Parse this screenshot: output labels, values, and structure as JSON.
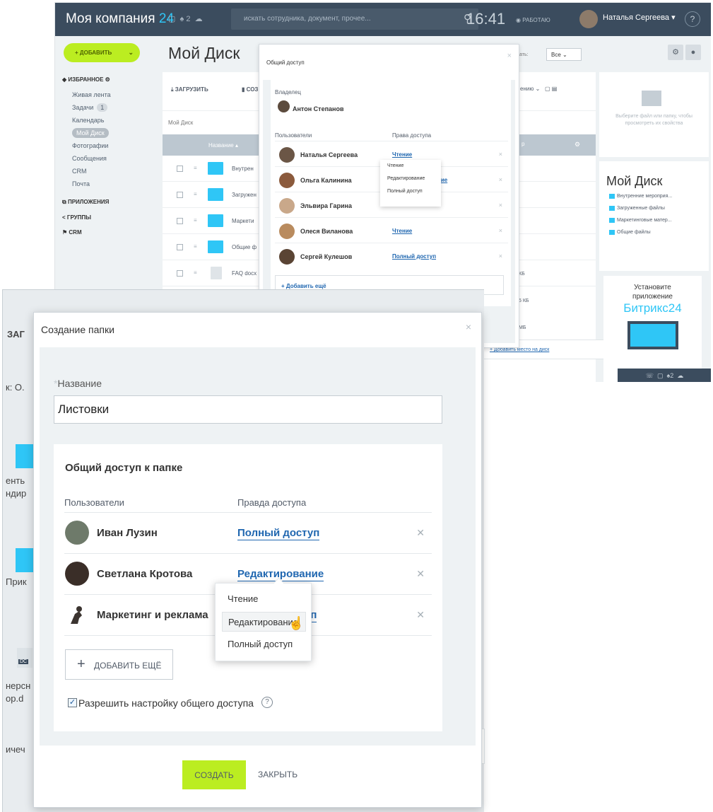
{
  "background": {
    "app_title": "Моя компания",
    "app_title_suffix": "24",
    "search_placeholder": "искать сотрудника, документ, прочее...",
    "clock": "16:41",
    "work_status": "РАБОТАЮ",
    "user_name": "Наталья Сергеева",
    "add_button": "+ ДОБАВИТЬ",
    "page_title": "Мой Диск",
    "menu": {
      "favorites_label": "ИЗБРАННОЕ",
      "items": [
        "Живая лента",
        "Задачи",
        "Календарь",
        "Мой Диск",
        "Фотографии",
        "Сообщения",
        "CRM",
        "Почта"
      ],
      "tasks_count": "1",
      "apps_label": "ПРИЛОЖЕНИЯ",
      "groups_label": "ГРУППЫ",
      "crm_label": "CRM"
    },
    "toolbar": {
      "upload": "ЗАГРУЗИТЬ",
      "create": "СОЗ"
    },
    "crumb": "Мой Диск",
    "col_name": "Название",
    "rows": [
      "Внутрен",
      "Загружен",
      "Маркети",
      "Общие ф",
      "FAQ docx"
    ],
    "sort_label": "ению",
    "sort_filter_label": "азать:",
    "sort_filter_value": "Все",
    "col_extra": "р",
    "extra_sizes": [
      "КБ",
      "5 КБ",
      "МБ"
    ],
    "add_space_link": "+ Добавить место на диск",
    "right_panel": {
      "hint": "Выберите файл или папку, чтобы просмотреть их свойства",
      "title": "Мой Диск",
      "items": [
        "Внутренние мероприя...",
        "Загруженные файлы",
        "Маркетинговые матер...",
        "Общие файлы"
      ],
      "promo_line1": "Установите",
      "promo_line2": "приложение",
      "promo_brand": "Битрикс24"
    },
    "share_dialog": {
      "title": "Общий доступ",
      "owner_label": "Владелец",
      "owner_name": "Антон Степанов",
      "col_users": "Пользователи",
      "col_rights": "Права доступа",
      "rows": [
        {
          "name": "Наталья Сергеева",
          "right": "Чтение"
        },
        {
          "name": "Ольга Калинина",
          "right": "ние"
        },
        {
          "name": "Эльвира Гарина",
          "right": ""
        },
        {
          "name": "Олеся Виланова",
          "right": "Чтение"
        },
        {
          "name": "Сергей Кулешов",
          "right": "Полный доступ"
        }
      ],
      "add_more": "+ Добавить ещё",
      "dropdown": [
        "Чтение",
        "Редактирование",
        "Полный доступ"
      ]
    }
  },
  "fg_back": {
    "fragments": [
      "ЗАГ",
      "к: О.",
      "енть",
      "ндир",
      "Прик",
      "нерсн",
      "op.d",
      "ичеч"
    ],
    "doc_label": "DC"
  },
  "modal": {
    "title": "Создание папки",
    "name_label": "Название",
    "name_required_mark": "*",
    "name_value": "Листовки",
    "share_title": "Общий доступ к папке",
    "col_users": "Пользователи",
    "col_rights": "Правда доступа",
    "rows": [
      {
        "name": "Иван Лузин",
        "right": "Полный доступ"
      },
      {
        "name": "Светлана Кротова",
        "right": "Редактирование"
      },
      {
        "name": "Маркетинг и реклама",
        "right": "уп"
      }
    ],
    "add_more": "ДОБАВИТЬ ЕЩЁ",
    "allow_setting_label": "Разрешить настройку общего доступа",
    "allow_setting_checked": true,
    "dropdown": [
      "Чтение",
      "Редактирование",
      "Полный доступ"
    ],
    "dropdown_hover": "Редактирование",
    "create_button": "СОЗДАТЬ",
    "close_button": "ЗАКРЫТЬ"
  }
}
